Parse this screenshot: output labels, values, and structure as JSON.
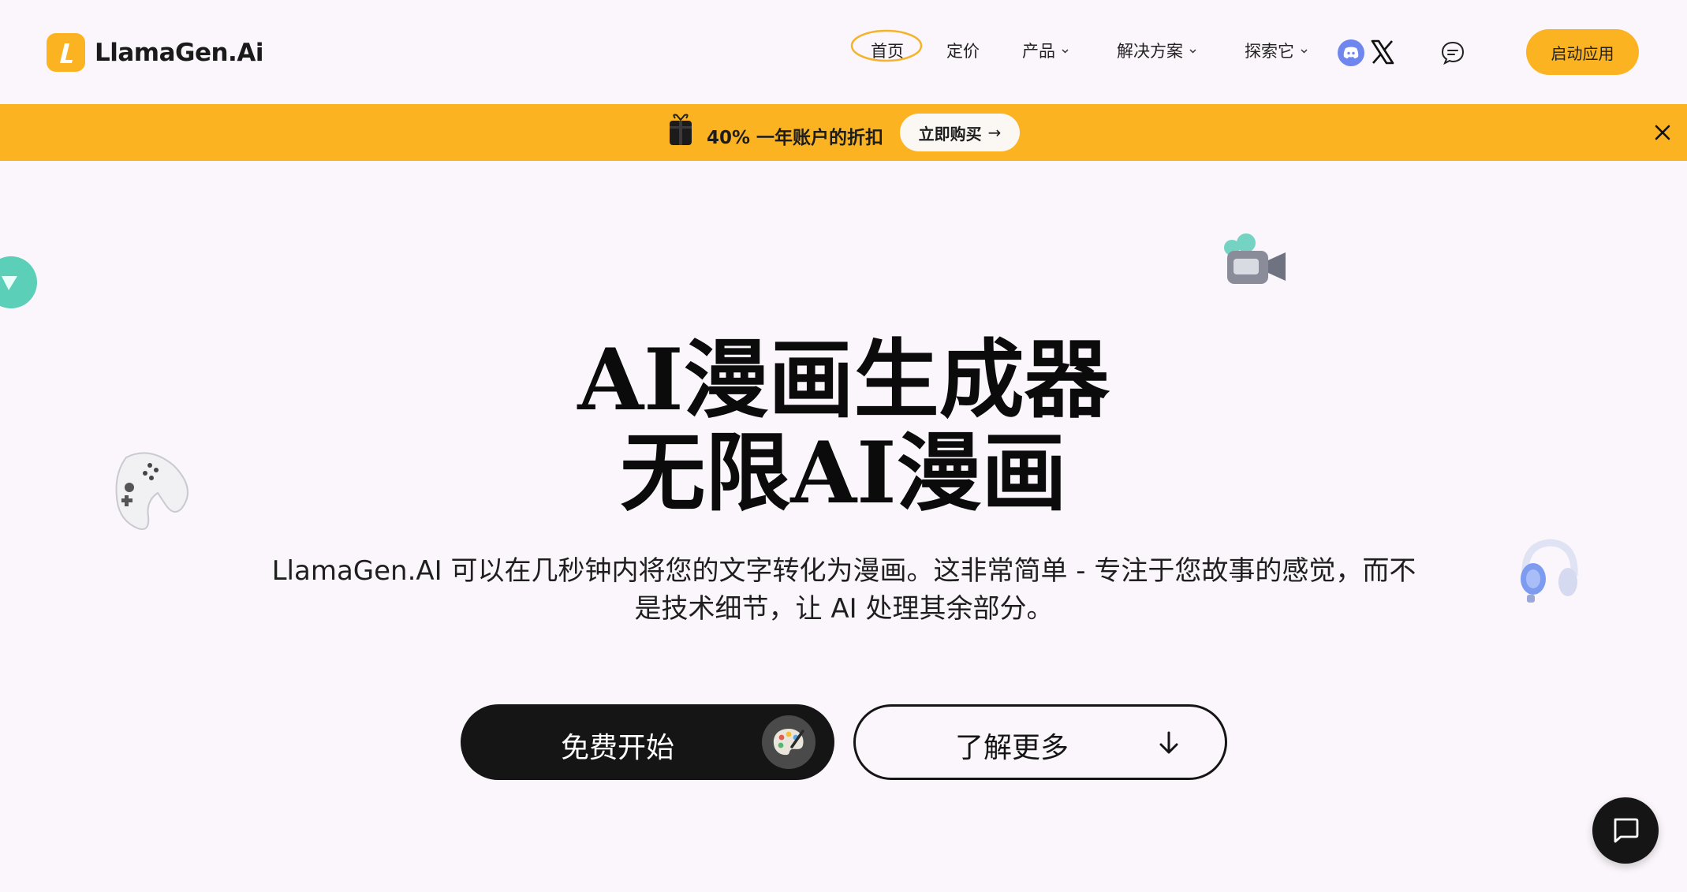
{
  "header": {
    "logo_text": "LlamaGen.Ai",
    "nav": {
      "home": "首页",
      "pricing": "定价",
      "products": "产品",
      "solutions": "解决方案",
      "explore": "探索它"
    },
    "launch_label": "启动应用"
  },
  "banner": {
    "text": "40% 一年账户的折扣",
    "buy_label": "立即购买",
    "buy_arrow": "→"
  },
  "hero": {
    "title_line1": "AI漫画生成器",
    "title_line2": "无限AI漫画",
    "subtitle_line1": "LlamaGen.AI 可以在几秒钟内将您的文字转化为漫画。这非常简单 - 专注于您故事的感觉，而不",
    "subtitle_line2": "是技术细节，让 AI 处理其余部分。",
    "start_label": "免费开始",
    "more_label": "了解更多"
  },
  "colors": {
    "accent": "#fbb321",
    "background": "#fbf6fb",
    "dark": "#151515",
    "discord": "#6e86ee"
  },
  "icons": [
    "logo-icon",
    "chevron-down-icon",
    "discord-icon",
    "x-icon",
    "chat-icon",
    "gift-icon",
    "close-icon",
    "palette-icon",
    "arrow-down-icon",
    "camera-icon",
    "gamepad-icon",
    "headphones-icon",
    "teal-orb-icon"
  ]
}
